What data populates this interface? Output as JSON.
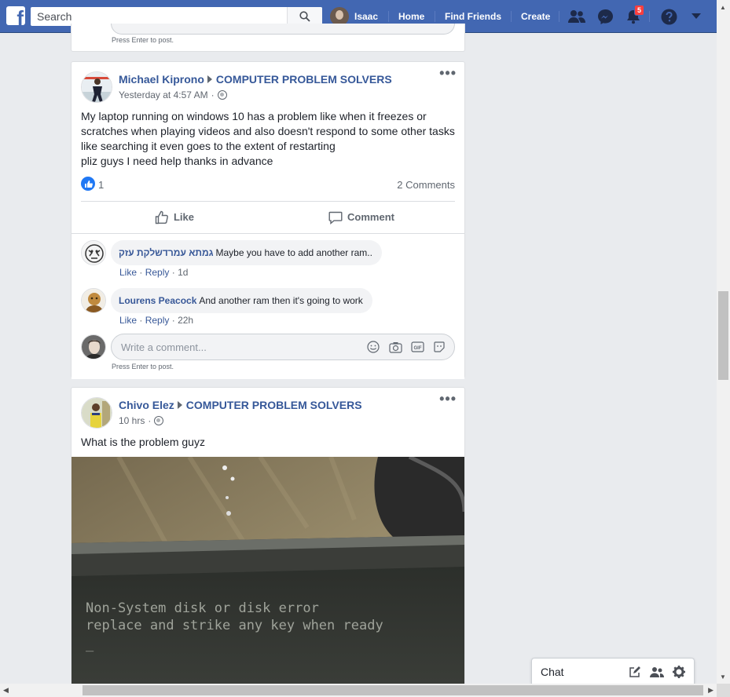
{
  "topbar": {
    "search_placeholder": "Search",
    "user_name": "Isaac",
    "home_label": "Home",
    "find_friends_label": "Find Friends",
    "create_label": "Create",
    "notifications_count": "5"
  },
  "prev_card": {
    "hint": "Press Enter to post."
  },
  "post1": {
    "author": "Michael Kiprono",
    "group": "COMPUTER PROBLEM SOLVERS",
    "time": "Yesterday at 4:57 AM",
    "meta_sep": "·",
    "text_lines": [
      "My laptop running on windows 10 has a problem like when it freezes or",
      "scratches when playing videos and also doesn't respond to some other tasks",
      "like searching it even goes to the extent of restarting",
      "pliz guys I need help thanks in advance"
    ],
    "reactions_count": "1",
    "comments_count": "2 Comments",
    "like_label": "Like",
    "comment_label": "Comment",
    "comments": [
      {
        "author": "גמתא עמרדשלקת עזק",
        "text": "Maybe you have to add another ram..",
        "like": "Like",
        "reply": "Reply",
        "time": "1d"
      },
      {
        "author": "Lourens Peacock",
        "text": "And another ram then it's going to work",
        "like": "Like",
        "reply": "Reply",
        "time": "22h"
      }
    ],
    "write_placeholder": "Write a comment...",
    "hint": "Press Enter to post."
  },
  "post2": {
    "author": "Chivo Elez",
    "group": "COMPUTER PROBLEM SOLVERS",
    "time": "10 hrs",
    "meta_sep": "·",
    "text": "What is the problem guyz",
    "image_line1": "Non-System disk or disk error",
    "image_line2": "replace and strike any key when ready",
    "image_cursor": "_"
  },
  "chat": {
    "label": "Chat"
  },
  "colors": {
    "brand": "#4267b2",
    "link": "#365899",
    "like": "#2078f4",
    "badge": "#fa3e3e"
  }
}
